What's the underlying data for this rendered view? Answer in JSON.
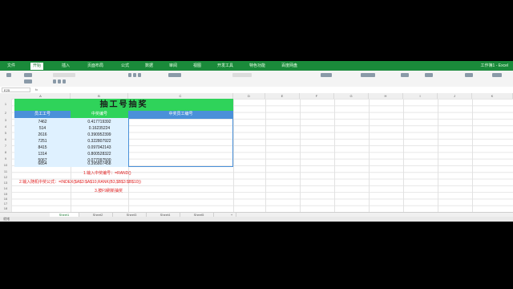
{
  "ribbon": {
    "tabs": [
      "文件",
      "开始",
      "插入",
      "页面布局",
      "公式",
      "数据",
      "审阅",
      "视图",
      "开发工具",
      "特色功能",
      "百度网盘"
    ],
    "active_tab_index": 1,
    "window_title": "工作簿1 - Excel"
  },
  "formula_bar": {
    "name_box": "E25",
    "fx": "fx"
  },
  "columns": [
    "A",
    "B",
    "C",
    "D",
    "E",
    "F",
    "G",
    "H",
    "I",
    "J",
    "K"
  ],
  "rows": [
    "1",
    "2",
    "3",
    "4",
    "5",
    "6",
    "7",
    "8",
    "9",
    "10",
    "11",
    "12",
    "13",
    "14",
    "15",
    "16",
    "17",
    "18",
    "19",
    "20",
    "21",
    "22"
  ],
  "sheet": {
    "title": "抽工号抽奖",
    "headers": [
      "员工工号",
      "中奖编号",
      "中奖员工编号"
    ],
    "data": [
      [
        "7462",
        "0.417719392"
      ],
      [
        "514",
        "0.16235224"
      ],
      [
        "2616",
        "0.390952399"
      ],
      [
        "7251",
        "0.322807922"
      ],
      [
        "8415",
        "0.097042143"
      ],
      [
        "1314",
        "0.800528322"
      ],
      [
        "5067",
        "0.077097500"
      ],
      [
        "6854",
        "0.395807458"
      ]
    ],
    "notes": [
      "1.输入中奖编号：=RAND()",
      "2.输入随机中奖公式：=INDEX($A$3:$A$10,RANK(B3,$B$3:$B$10))",
      "3.按F9刷新抽奖"
    ]
  },
  "sheet_tabs": [
    "Sheet1",
    "Sheet2",
    "Sheet3",
    "Sheet4",
    "Sheet5",
    "+"
  ],
  "active_sheet_index": 0,
  "status_text": "就绪"
}
